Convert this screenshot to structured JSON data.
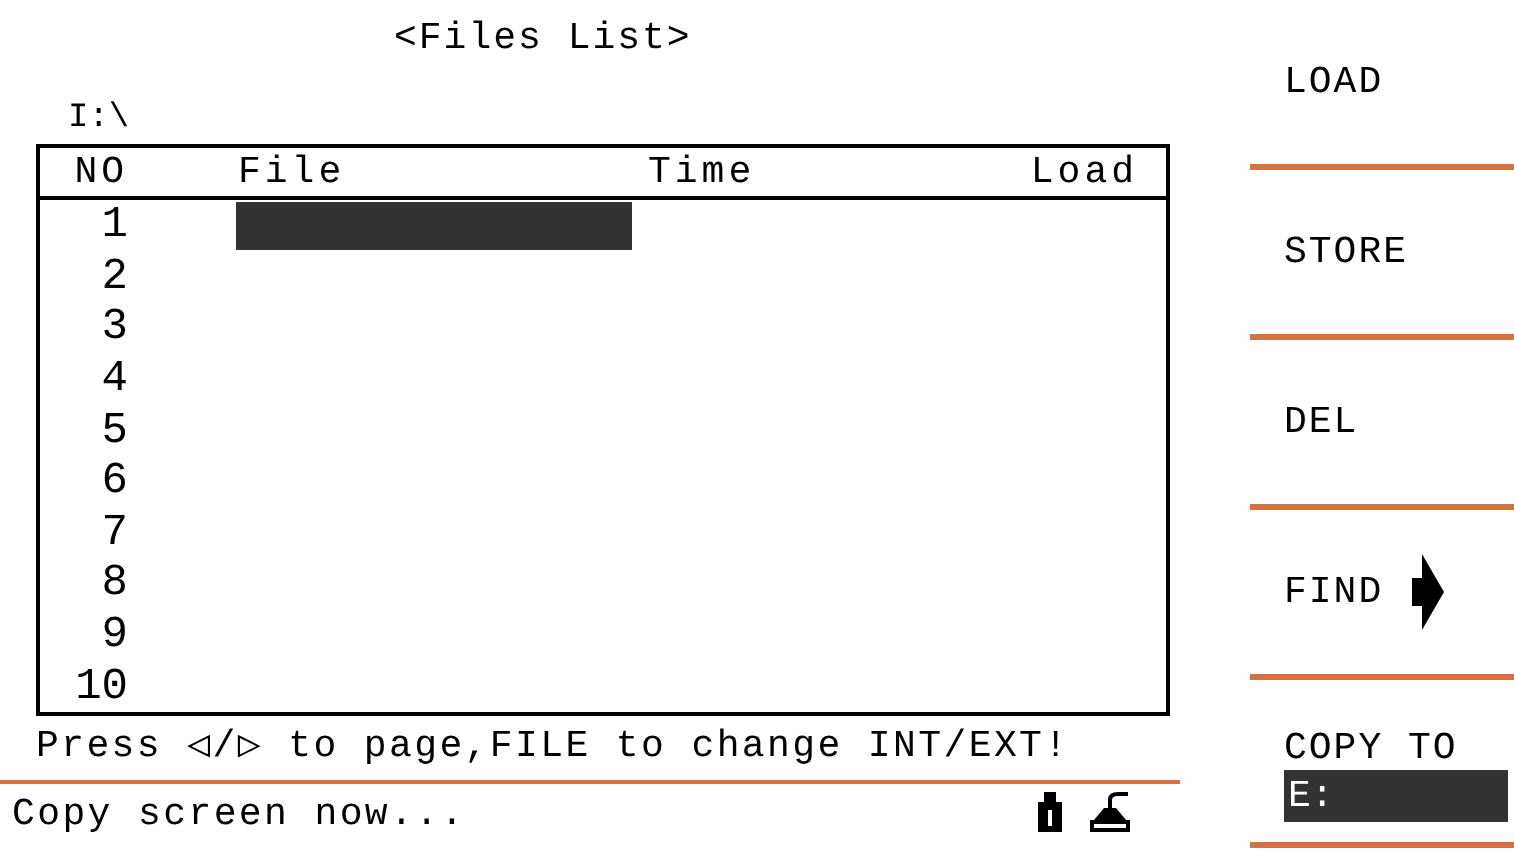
{
  "title": "<Files List>",
  "path": "I:\\",
  "columns": [
    "NO",
    "File",
    "Time",
    "Load"
  ],
  "rows": [
    {
      "no": "1",
      "selected": true
    },
    {
      "no": "2",
      "selected": false
    },
    {
      "no": "3",
      "selected": false
    },
    {
      "no": "4",
      "selected": false
    },
    {
      "no": "5",
      "selected": false
    },
    {
      "no": "6",
      "selected": false
    },
    {
      "no": "7",
      "selected": false
    },
    {
      "no": "8",
      "selected": false
    },
    {
      "no": "9",
      "selected": false
    },
    {
      "no": "10",
      "selected": false
    }
  ],
  "hint": "Press ◁/▷ to page,FILE to change INT/EXT!",
  "status": "Copy screen now...",
  "softkeys": [
    {
      "kind": "plain",
      "label": "LOAD"
    },
    {
      "kind": "plain",
      "label": "STORE"
    },
    {
      "kind": "plain",
      "label": "DEL"
    },
    {
      "kind": "arrow",
      "label": "FIND"
    },
    {
      "kind": "field",
      "label": "COPY TO",
      "value": "E:"
    }
  ]
}
